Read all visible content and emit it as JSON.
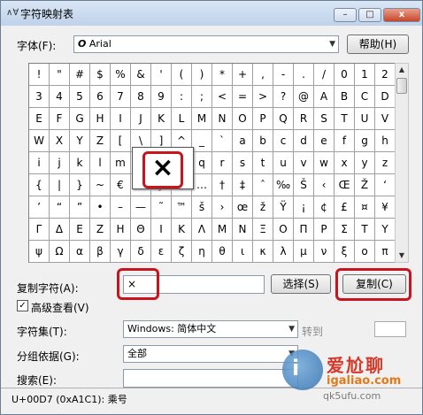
{
  "window": {
    "title": "字符映射表",
    "app_icon": "∧∀",
    "controls": {
      "minimize": "–",
      "maximize": "□",
      "close": "x"
    }
  },
  "font": {
    "label": "字体(F):",
    "font_icon": "O",
    "value": "Arial",
    "help_button": "帮助(H)"
  },
  "char_grid": {
    "rows": [
      [
        "!",
        "\"",
        "#",
        "$",
        "%",
        "&",
        "'",
        "(",
        ")",
        "*",
        "+",
        ",",
        "-",
        ".",
        "/",
        "0",
        "1",
        "2"
      ],
      [
        "3",
        "4",
        "5",
        "6",
        "7",
        "8",
        "9",
        ":",
        ";",
        "<",
        "=",
        ">",
        "?",
        "@",
        "A",
        "B",
        "C",
        "D"
      ],
      [
        "E",
        "F",
        "G",
        "H",
        "I",
        "J",
        "K",
        "L",
        "M",
        "N",
        "O",
        "P",
        "Q",
        "R",
        "S",
        "T",
        "U",
        "V"
      ],
      [
        "W",
        "X",
        "Y",
        "Z",
        "[",
        "\\",
        "]",
        "^",
        "_",
        "`",
        "a",
        "b",
        "c",
        "d",
        "e",
        "f",
        "g",
        "h"
      ],
      [
        "i",
        "j",
        "k",
        "l",
        "m",
        "n",
        "o",
        "p",
        "q",
        "r",
        "s",
        "t",
        "u",
        "v",
        "w",
        "x",
        "y",
        "z"
      ],
      [
        "{",
        "|",
        "}",
        "~",
        "€",
        "‚",
        "ƒ",
        "„",
        "…",
        "†",
        "‡",
        "ˆ",
        "‰",
        "Š",
        "‹",
        "Œ",
        "Ž",
        "‘"
      ],
      [
        "’",
        "“",
        "”",
        "•",
        "–",
        "—",
        "˜",
        "™",
        "š",
        "›",
        "œ",
        "ž",
        "Ÿ",
        "¡",
        "¢",
        "£",
        "¤",
        "¥"
      ],
      [
        "Γ",
        "Δ",
        "Ε",
        "Ζ",
        "Η",
        "Θ",
        "Ι",
        "Κ",
        "Λ",
        "Μ",
        "Ν",
        "Ξ",
        "Ο",
        "Π",
        "Ρ",
        "Σ",
        "Τ",
        "Υ"
      ],
      [
        "ψ",
        "Ω",
        "α",
        "β",
        "γ",
        "δ",
        "ε",
        "ζ",
        "η",
        "θ",
        "ι",
        "κ",
        "λ",
        "μ",
        "ν",
        "ξ",
        "ο",
        "π"
      ]
    ],
    "magnified_char": "×"
  },
  "copy": {
    "label": "复制字符(A):",
    "value": "×",
    "select_button": "选择(S)",
    "copy_button": "复制(C)"
  },
  "advanced": {
    "checked": true,
    "check_mark": "✓",
    "label": "高级查看(V)"
  },
  "charset": {
    "label": "字符集(T):",
    "value": "Windows: 简体中文",
    "goto_label": "转到"
  },
  "group_by": {
    "label": "分组依据(G):",
    "value": "全部"
  },
  "search": {
    "label": "搜索(E):",
    "value": ""
  },
  "status": {
    "text": "U+00D7 (0xA1C1): 乘号"
  },
  "watermark": {
    "logo": "i",
    "title": "爱尬聊",
    "url": "igaliao.com",
    "url2": "qk5ufu.com"
  },
  "colors": {
    "highlight": "#c8141e",
    "title_gradient_top": "#d9e6f5",
    "title_gradient_bottom": "#bfd2ea"
  }
}
